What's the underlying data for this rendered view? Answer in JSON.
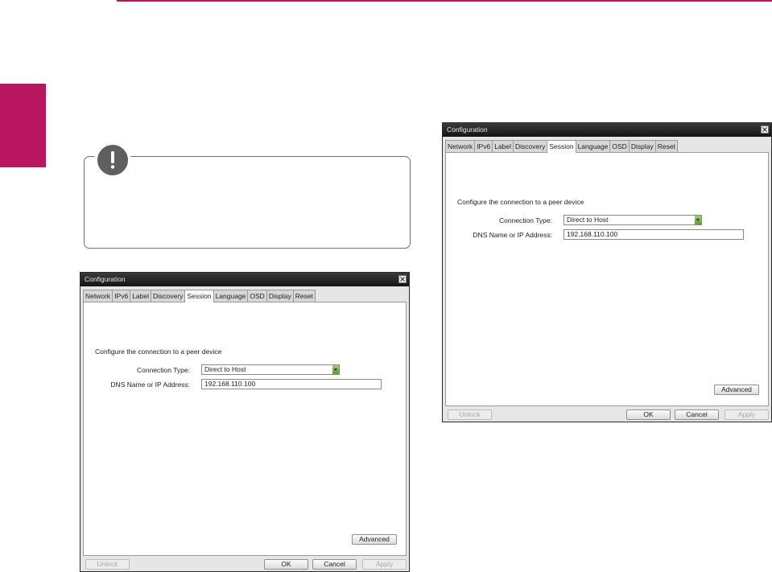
{
  "dialog": {
    "title": "Configuration",
    "tabs": [
      "Network",
      "IPv6",
      "Label",
      "Discovery",
      "Session",
      "Language",
      "OSD",
      "Display",
      "Reset"
    ],
    "active_tab": "Session",
    "description": "Configure the connection to a peer device",
    "connection_type": {
      "label": "Connection Type:",
      "value": "Direct to Host"
    },
    "dns": {
      "label": "DNS Name or IP Address:",
      "value": "192.168.110.100"
    },
    "buttons": {
      "advanced": "Advanced",
      "unlock": "Unlock",
      "ok": "OK",
      "cancel": "Cancel",
      "apply": "Apply"
    }
  },
  "colors": {
    "accent": "#b8175f",
    "note_icon": "#5f5f5f",
    "dropdown_arrow": "#6aaa35"
  },
  "icons": {
    "note": "exclamation-icon",
    "close": "close-icon",
    "dropdown": "chevron-down-icon"
  }
}
